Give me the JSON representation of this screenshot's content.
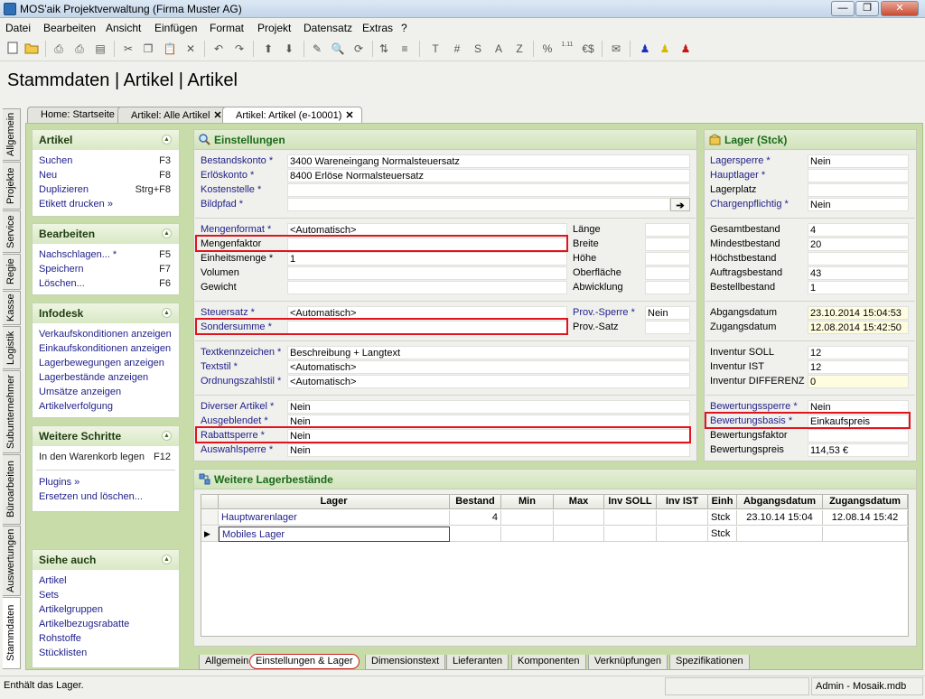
{
  "window": {
    "title": "MOS'aik Projektverwaltung (Firma Muster AG)",
    "min": "—",
    "max": "❐",
    "close": "✕"
  },
  "menu": [
    "Datei",
    "Bearbeiten",
    "Ansicht",
    "Einfügen",
    "Format",
    "Projekt",
    "Datensatz",
    "Extras",
    "?"
  ],
  "toolbar_format_labels": [
    "T",
    "#",
    "S",
    "A",
    "Z",
    "%",
    "1.11",
    "€$"
  ],
  "page_title": "Stammdaten | Artikel | Artikel",
  "vertical_tabs": [
    "Allgemein",
    "Projekte",
    "Service",
    "Regie",
    "Kasse",
    "Logistik",
    "Subunternehmer",
    "Büroarbeiten",
    "Auswertungen",
    "Stammdaten"
  ],
  "doc_tabs": [
    {
      "label": "Home: Startseite"
    },
    {
      "label": "Artikel: Alle Artikel",
      "close": "✕"
    },
    {
      "label": "Artikel: Artikel (e-10001)",
      "close": "✕"
    }
  ],
  "left": {
    "artikel": {
      "title": "Artikel",
      "items": [
        {
          "label": "Suchen",
          "key": "F3"
        },
        {
          "label": "Neu",
          "key": "F8"
        },
        {
          "label": "Duplizieren",
          "key": "Strg+F8"
        },
        {
          "label": "Etikett drucken »",
          "key": ""
        }
      ]
    },
    "bearbeiten": {
      "title": "Bearbeiten",
      "items": [
        {
          "label": "Nachschlagen... *",
          "key": "F5"
        },
        {
          "label": "Speichern",
          "key": "F7"
        },
        {
          "label": "Löschen...",
          "key": "F6"
        }
      ]
    },
    "infodesk": {
      "title": "Infodesk",
      "items": [
        {
          "label": "Verkaufskonditionen anzeigen"
        },
        {
          "label": "Einkaufskonditionen anzeigen"
        },
        {
          "label": "Lagerbewegungen anzeigen"
        },
        {
          "label": "Lagerbestände anzeigen"
        },
        {
          "label": "Umsätze anzeigen"
        },
        {
          "label": "Artikelverfolgung"
        }
      ]
    },
    "weitere": {
      "title": "Weitere Schritte",
      "items": [
        {
          "label": "In den Warenkorb legen",
          "key": "F12"
        },
        {
          "label": "Plugins »"
        },
        {
          "label": "Ersetzen und löschen..."
        }
      ]
    },
    "siehe": {
      "title": "Siehe auch",
      "items": [
        {
          "label": "Artikel"
        },
        {
          "label": "Sets"
        },
        {
          "label": "Artikelgruppen"
        },
        {
          "label": "Artikelbezugsrabatte"
        },
        {
          "label": "Rohstoffe"
        },
        {
          "label": "Stücklisten"
        }
      ]
    }
  },
  "einstellungen": {
    "title": "Einstellungen",
    "bestandskonto": {
      "label": "Bestandskonto *",
      "value": "3400 Wareneingang Normalsteuersatz"
    },
    "erloeskonto": {
      "label": "Erlöskonto *",
      "value": "8400 Erlöse Normalsteuersatz"
    },
    "kostenstelle": {
      "label": "Kostenstelle *",
      "value": ""
    },
    "bildpfad": {
      "label": "Bildpfad *",
      "value": "",
      "button": "➔"
    },
    "mengenformat": {
      "label": "Mengenformat *",
      "value": "<Automatisch>"
    },
    "mengenfaktor": {
      "label": "Mengenfaktor",
      "value": ""
    },
    "einheitsmenge": {
      "label": "Einheitsmenge *",
      "value": "1"
    },
    "volumen": {
      "label": "Volumen",
      "value": ""
    },
    "gewicht": {
      "label": "Gewicht",
      "value": ""
    },
    "laenge": {
      "label": "Länge",
      "value": ""
    },
    "breite": {
      "label": "Breite",
      "value": ""
    },
    "hoehe": {
      "label": "Höhe",
      "value": ""
    },
    "oberflaeche": {
      "label": "Oberfläche",
      "value": ""
    },
    "abwicklung": {
      "label": "Abwicklung",
      "value": ""
    },
    "steuersatz": {
      "label": "Steuersatz *",
      "value": "<Automatisch>"
    },
    "sondersumme": {
      "label": "Sondersumme *",
      "value": ""
    },
    "provsperre": {
      "label": "Prov.-Sperre *",
      "value": "Nein"
    },
    "provsatz": {
      "label": "Prov.-Satz",
      "value": ""
    },
    "textkennzeichen": {
      "label": "Textkennzeichen *",
      "value": "Beschreibung + Langtext"
    },
    "textstil": {
      "label": "Textstil *",
      "value": "<Automatisch>"
    },
    "ordnungszahlstil": {
      "label": "Ordnungszahlstil *",
      "value": "<Automatisch>"
    },
    "diverser": {
      "label": "Diverser Artikel *",
      "value": "Nein"
    },
    "ausgeblendet": {
      "label": "Ausgeblendet *",
      "value": "Nein"
    },
    "rabattsperre": {
      "label": "Rabattsperre *",
      "value": "Nein"
    },
    "auswahlsperre": {
      "label": "Auswahlsperre *",
      "value": "Nein"
    }
  },
  "lager": {
    "title": "Lager (Stck)",
    "lagersperre": {
      "label": "Lagersperre *",
      "value": "Nein"
    },
    "hauptlager": {
      "label": "Hauptlager *",
      "value": ""
    },
    "lagerplatz": {
      "label": "Lagerplatz",
      "value": ""
    },
    "chargenpflichtig": {
      "label": "Chargenpflichtig *",
      "value": "Nein"
    },
    "gesamtbestand": {
      "label": "Gesamtbestand",
      "value": "4"
    },
    "mindestbestand": {
      "label": "Mindestbestand",
      "value": "20"
    },
    "hoechstbestand": {
      "label": "Höchstbestand",
      "value": ""
    },
    "auftragsbestand": {
      "label": "Auftragsbestand",
      "value": "43"
    },
    "bestellbestand": {
      "label": "Bestellbestand",
      "value": "1"
    },
    "abgangsdatum": {
      "label": "Abgangsdatum",
      "value": "23.10.2014 15:04:53"
    },
    "zugangsdatum": {
      "label": "Zugangsdatum",
      "value": "12.08.2014 15:42:50"
    },
    "inventur_soll": {
      "label": "Inventur SOLL",
      "value": "12"
    },
    "inventur_ist": {
      "label": "Inventur IST",
      "value": "12"
    },
    "inventur_diff": {
      "label": "Inventur DIFFERENZ",
      "value": "0"
    },
    "bewertungssperre": {
      "label": "Bewertungssperre *",
      "value": "Nein"
    },
    "bewertungsbasis": {
      "label": "Bewertungsbasis *",
      "value": "Einkaufspreis"
    },
    "bewertungsfaktor": {
      "label": "Bewertungsfaktor",
      "value": ""
    },
    "bewertungspreis": {
      "label": "Bewertungspreis",
      "value": "114,53 €"
    }
  },
  "weitere_lager": {
    "title": "Weitere Lagerbestände",
    "columns": [
      "Lager",
      "Bestand",
      "Min",
      "Max",
      "Inv SOLL",
      "Inv IST",
      "Einh",
      "Abgangsdatum",
      "Zugangsdatum"
    ],
    "rows": [
      [
        "Hauptwarenlager",
        "4",
        "",
        "",
        "",
        "",
        "Stck",
        "23.10.14 15:04",
        "12.08.14 15:42"
      ],
      [
        "Mobiles Lager",
        "",
        "",
        "",
        "",
        "",
        "Stck",
        "",
        ""
      ]
    ]
  },
  "bottom_tabs": [
    "Allgemein",
    "Einstellungen & Lager",
    "Dimensionstext",
    "Lieferanten",
    "Komponenten",
    "Verknüpfungen",
    "Spezifikationen"
  ],
  "status": {
    "left": "Enthält das Lager.",
    "right": "Admin - Mosaik.mdb"
  }
}
